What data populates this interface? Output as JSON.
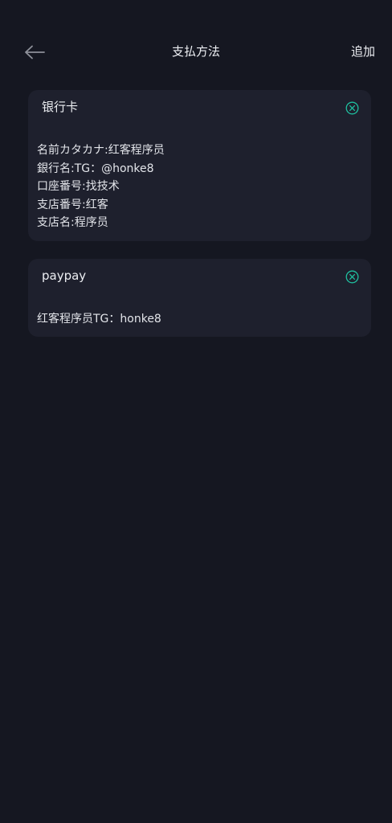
{
  "header": {
    "title": "支払方法",
    "add_label": "追加"
  },
  "icons": {
    "back": "arrow-left-icon",
    "remove": "circle-x-icon"
  },
  "colors": {
    "background": "#151721",
    "card": "#1e202d",
    "accent": "#1fc1a0"
  },
  "methods": [
    {
      "title": "银行卡",
      "lines": [
        "名前カタカナ:红客程序员",
        "銀行名:TG：@honke8",
        "口座番号:找技术",
        "支店番号:红客",
        "支店名:程序员"
      ]
    },
    {
      "title": "paypay",
      "lines": [
        "红客程序员TG：honke8"
      ]
    }
  ]
}
